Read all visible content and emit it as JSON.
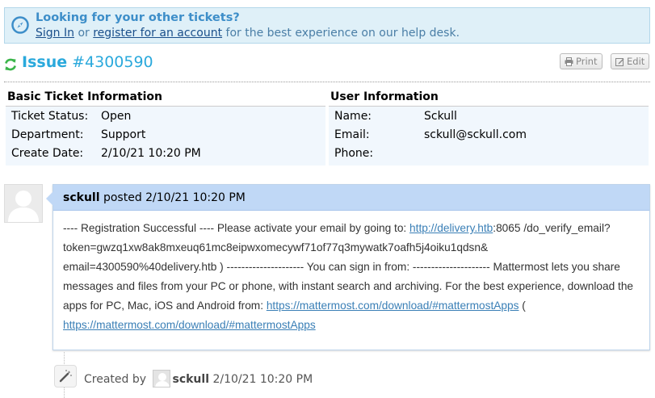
{
  "notice": {
    "title": "Looking for your other tickets?",
    "sign_in": "Sign In",
    "or": " or ",
    "register": "register for an account",
    "rest": " for the best experience on our help desk."
  },
  "ticket": {
    "issue_label": "Issue",
    "number": "#4300590",
    "print_label": "Print",
    "edit_label": "Edit"
  },
  "basic_info": {
    "heading": "Basic Ticket Information",
    "rows": [
      {
        "label": "Ticket Status:",
        "value": "Open"
      },
      {
        "label": "Department:",
        "value": "Support"
      },
      {
        "label": "Create Date:",
        "value": "2/10/21 10:20 PM"
      }
    ]
  },
  "user_info": {
    "heading": "User Information",
    "rows": [
      {
        "label": "Name:",
        "value": "Sckull"
      },
      {
        "label": "Email:",
        "value": "sckull@sckull.com"
      },
      {
        "label": "Phone:",
        "value": ""
      }
    ]
  },
  "entry": {
    "author": "sckull",
    "posted": " posted 2/10/21 10:20 PM",
    "text1": "---- Registration Successful ---- Please activate your email by going to: ",
    "link1": "http://delivery.htb",
    "text2": ":8065 /do_verify_email?token=gwzq1xw8ak8mxeuq61mc8eipwxomecywf71of77q3mywatk7oafh5j4oiku1qdsn& email=4300590%40delivery.htb ) --------------------- You can sign in from: --------------------- Mattermost lets you share messages and files from your PC or phone, with instant search and archiving. For the best experience, download the apps for PC, Mac, iOS and Android from: ",
    "link2": "https://mattermost.com/download/#mattermostApps",
    "text3": " ( ",
    "link3": "https://mattermost.com/download/#mattermostApps"
  },
  "event": {
    "created_by": "Created by",
    "author": "sckull",
    "date": " 2/10/21 10:20 PM"
  },
  "colors": {
    "accent": "#2aa9dc",
    "notice_bg": "#dff0f8",
    "entry_header_bg": "#c0d8f6",
    "refresh_green": "#3bb54a"
  }
}
